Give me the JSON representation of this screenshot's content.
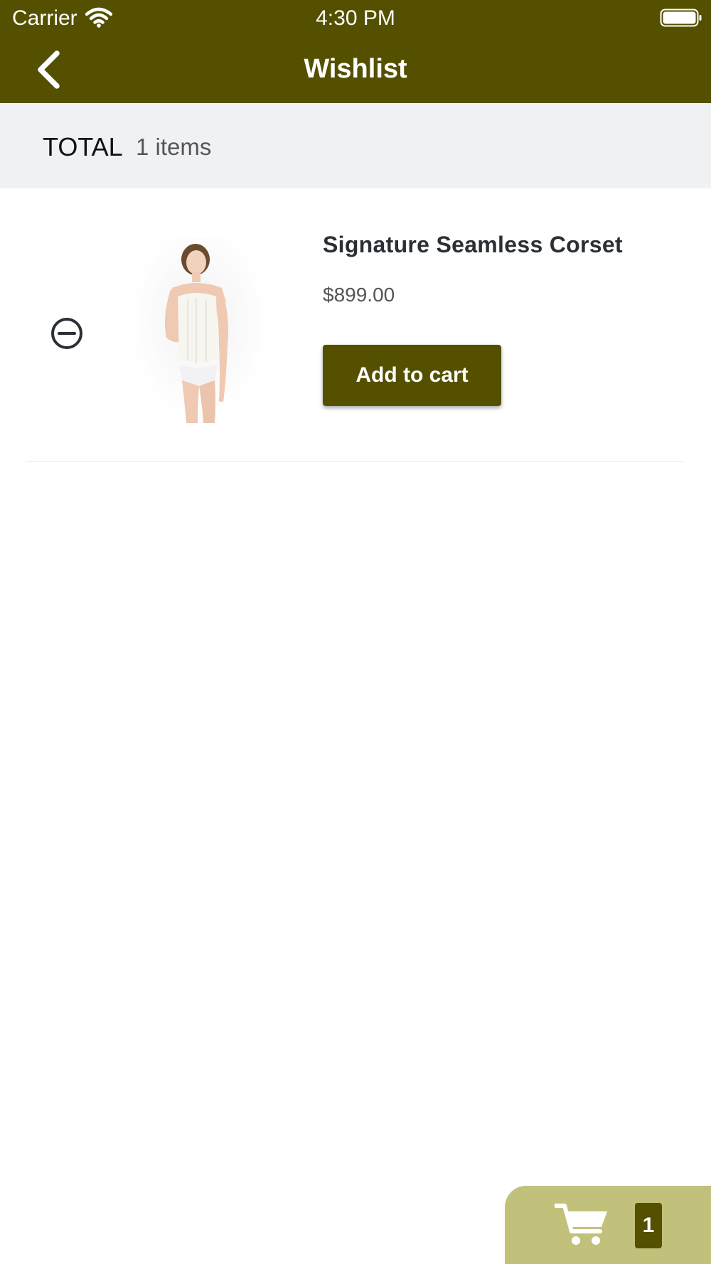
{
  "status_bar": {
    "carrier": "Carrier",
    "time": "4:30 PM",
    "wifi_icon": "wifi-icon",
    "battery_icon": "battery-full-icon"
  },
  "header": {
    "title": "Wishlist",
    "back_icon": "chevron-left-icon",
    "background_color": "#545000"
  },
  "summary": {
    "total_label": "TOTAL",
    "items_count": "1 items"
  },
  "wishlist_items": [
    {
      "name": "Signature Seamless Corset",
      "price": "$899.00",
      "add_to_cart_label": "Add to cart",
      "remove_icon": "minus-circle-icon",
      "image": "product-image-corset"
    }
  ],
  "cart_fab": {
    "icon": "cart-icon",
    "badge_count": "1",
    "background_color": "#c2c17c"
  },
  "colors": {
    "primary": "#545000",
    "accent_light": "#c2c17c",
    "summary_bg": "#f0f1f3"
  }
}
